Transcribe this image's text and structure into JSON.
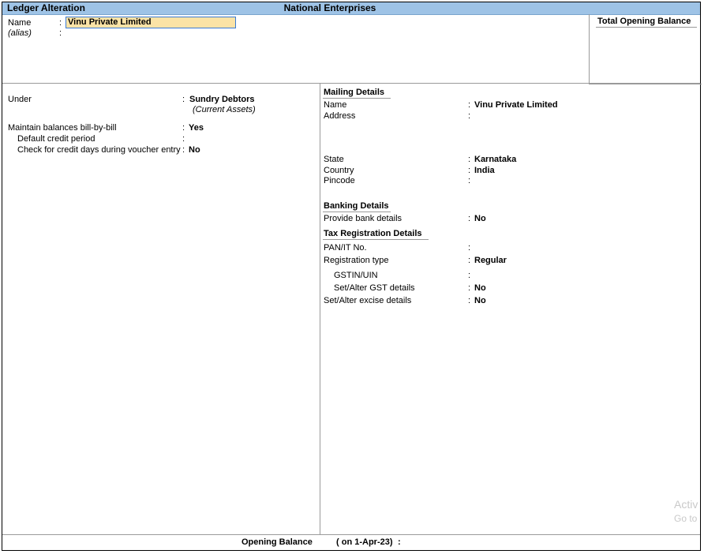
{
  "window": {
    "screen_title": "Ledger Alteration",
    "company": "National Enterprises"
  },
  "header": {
    "name_label": "Name",
    "name_value": "Vinu Private Limited",
    "alias_label": "(alias)",
    "total_opening_balance_label": "Total Opening Balance"
  },
  "left": {
    "under_label": "Under",
    "under_value": "Sundry Debtors",
    "under_parent": "(Current Assets)",
    "billwise_label": "Maintain balances bill-by-bill",
    "billwise_value": "Yes",
    "credit_period_label": "Default credit period",
    "credit_days_label": "Check for credit days during voucher entry",
    "credit_days_value": "No"
  },
  "mailing": {
    "title": "Mailing Details",
    "name_label": "Name",
    "name_value": "Vinu Private Limited",
    "address_label": "Address",
    "state_label": "State",
    "state_value": "Karnataka",
    "country_label": "Country",
    "country_value": "India",
    "pincode_label": "Pincode"
  },
  "banking": {
    "title": "Banking Details",
    "provide_label": "Provide bank details",
    "provide_value": "No"
  },
  "tax": {
    "title": "Tax Registration Details",
    "pan_label": "PAN/IT No.",
    "reg_type_label": "Registration type",
    "reg_type_value": "Regular",
    "gstin_label": "GSTIN/UIN",
    "gst_details_label": "Set/Alter GST details",
    "gst_details_value": "No",
    "excise_label": "Set/Alter excise details",
    "excise_value": "No"
  },
  "footer": {
    "opening_balance_label": "Opening Balance",
    "as_on": "( on 1-Apr-23)",
    "colon": ":"
  },
  "watermark": {
    "line1": "Activ",
    "line2": "Go to"
  },
  "colors": {
    "title_bar": "#9ec3e6",
    "input_bg": "#fbe3a6",
    "input_border": "#3a7bd5"
  }
}
